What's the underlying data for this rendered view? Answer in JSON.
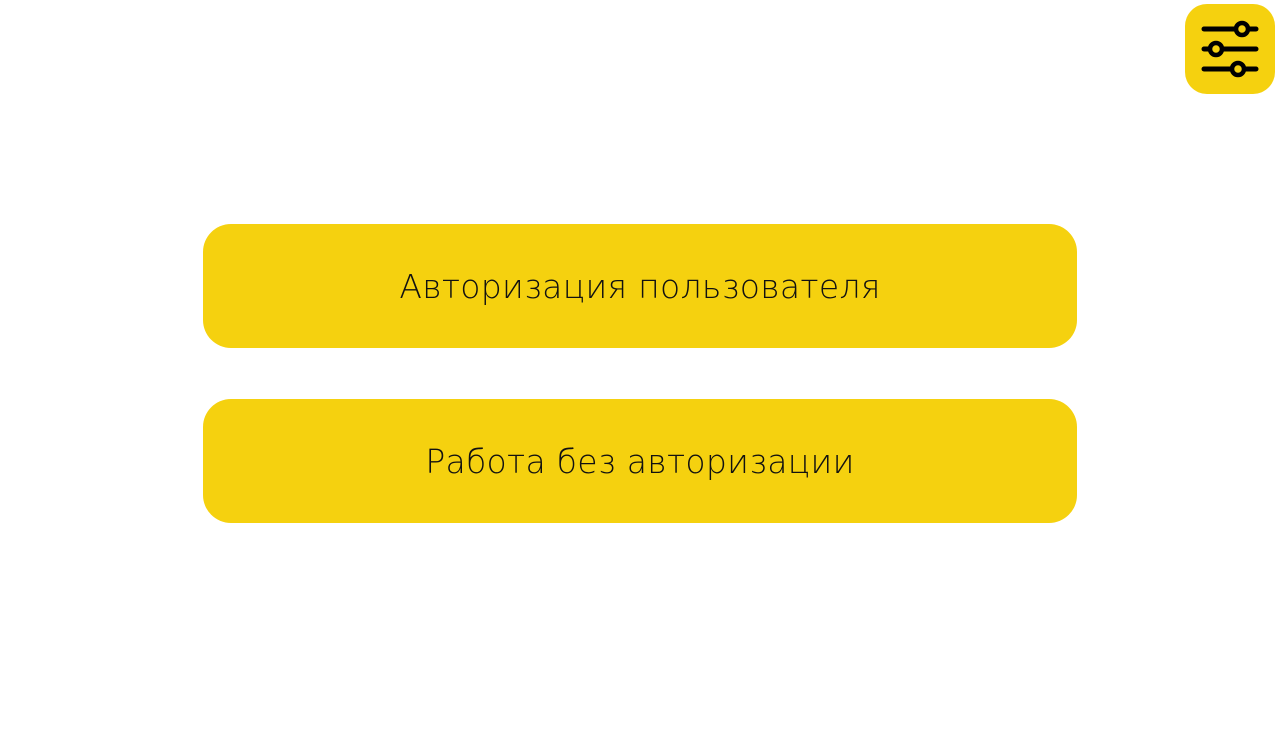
{
  "settings_button": {
    "icon": "sliders-icon"
  },
  "menu": {
    "login_label": "Авторизация пользователя",
    "guest_label": "Работа без авторизации"
  },
  "colors": {
    "accent": "#f5d10f",
    "background": "#ffffff",
    "text": "#111111"
  }
}
